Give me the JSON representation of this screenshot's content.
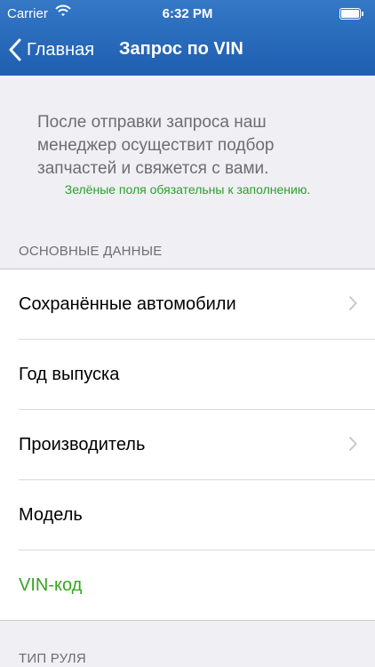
{
  "status_bar": {
    "carrier": "Carrier",
    "time": "6:32 PM",
    "wifi_icon": "wifi-icon",
    "battery_icon": "battery-icon"
  },
  "nav": {
    "back_label": "Главная",
    "title": "Запрос по VIN",
    "back_icon": "chevron-left-icon"
  },
  "info": {
    "description": "После отправки запроса наш менеджер осуществит подбор запчастей и свяжется с вами.",
    "required_hint": "Зелёные поля обязательны к заполнению."
  },
  "sections": [
    {
      "header": "ОСНОВНЫЕ ДАННЫЕ",
      "rows": [
        {
          "label": "Сохранённые автомобили",
          "chevron": true,
          "required": false
        },
        {
          "label": "Год выпуска",
          "chevron": false,
          "required": false
        },
        {
          "label": "Производитель",
          "chevron": true,
          "required": false
        },
        {
          "label": "Модель",
          "chevron": false,
          "required": false
        },
        {
          "label": "VIN-код",
          "chevron": false,
          "required": true
        }
      ]
    },
    {
      "header": "ТИП РУЛЯ",
      "rows": []
    }
  ],
  "colors": {
    "nav_bar": "#1f5eb0",
    "required_green": "#34a51e",
    "hint_green": "#2ca02c",
    "background": "#efeff4"
  }
}
